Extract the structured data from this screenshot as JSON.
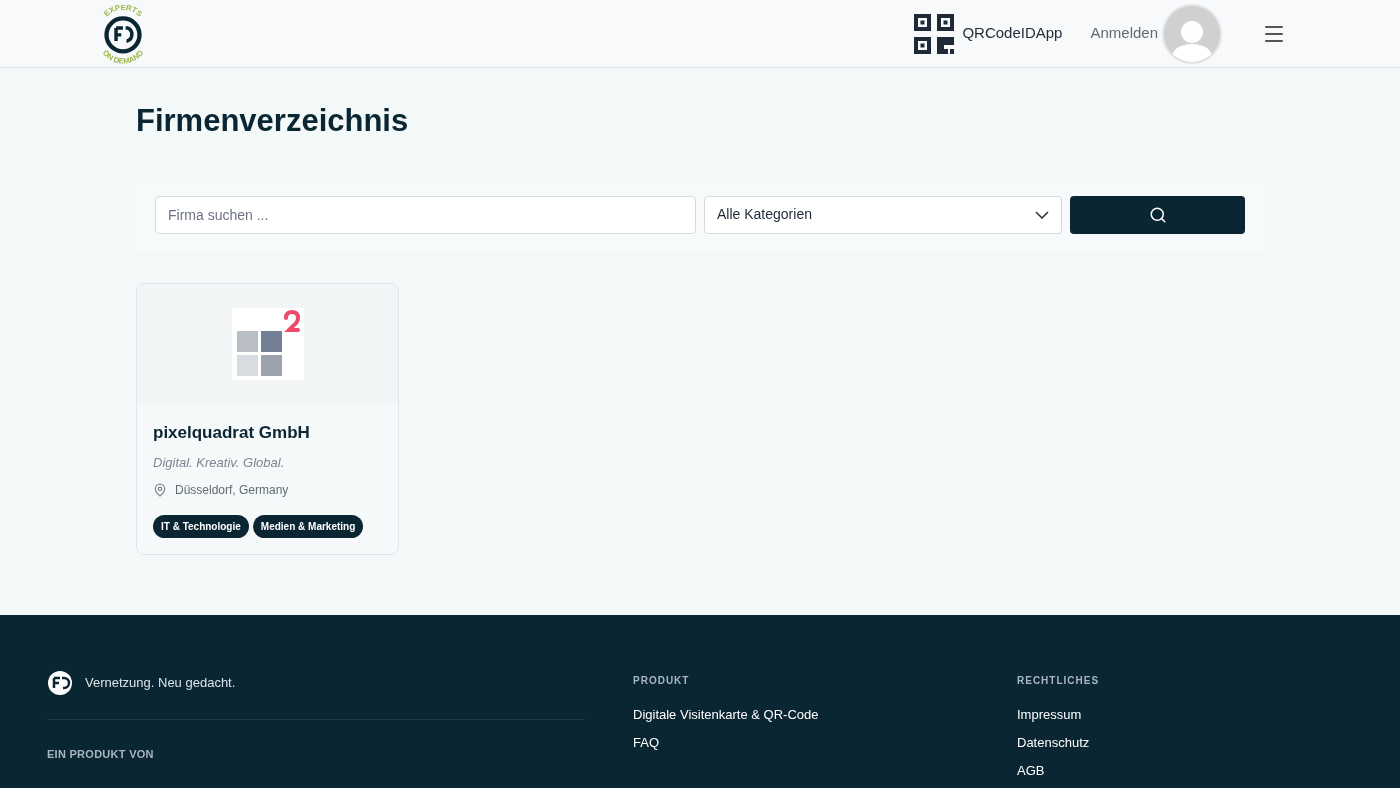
{
  "header": {
    "logo": {
      "top_text": "EXPERTS",
      "bottom_text": "ON DEMAND"
    },
    "app_link": "QRCodeIDApp",
    "login": "Anmelden"
  },
  "page_title": "Firmenverzeichnis",
  "search": {
    "placeholder": "Firma suchen ...",
    "category": "Alle Kategorien"
  },
  "companies": [
    {
      "name": "pixelquadrat GmbH",
      "tagline": "Digital. Kreativ. Global.",
      "location": "Düsseldorf, Germany",
      "tags": [
        "IT & Technologie",
        "Medien & Marketing"
      ]
    }
  ],
  "footer": {
    "tagline": "Vernetzung. Neu gedacht.",
    "producer_heading": "EIN PRODUKT VON",
    "columns": [
      {
        "heading": "PRODUKT",
        "links": [
          "Digitale Visitenkarte & QR-Code",
          "FAQ"
        ]
      },
      {
        "heading": "RECHTLICHES",
        "links": [
          "Impressum",
          "Datenschutz",
          "AGB"
        ]
      }
    ]
  }
}
